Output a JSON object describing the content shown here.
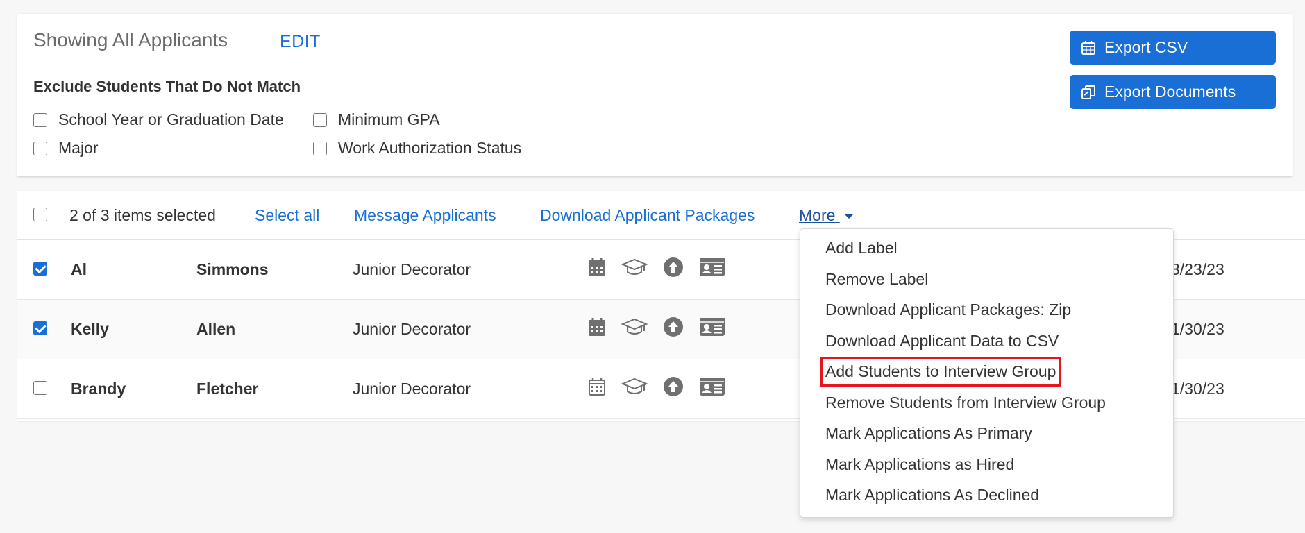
{
  "filters": {
    "title": "Showing All Applicants",
    "edit_label": "EDIT",
    "exclude_heading": "Exclude Students That Do Not Match",
    "options": [
      {
        "label": "School Year or Graduation Date",
        "checked": false
      },
      {
        "label": "Minimum GPA",
        "checked": false
      },
      {
        "label": "Major",
        "checked": false
      },
      {
        "label": "Work Authorization Status",
        "checked": false
      }
    ]
  },
  "actions": {
    "export_csv": "Export CSV",
    "export_documents": "Export Documents"
  },
  "toolbar": {
    "selected_text": "2 of 3 items selected",
    "select_all": "Select all",
    "message": "Message Applicants",
    "download": "Download Applicant Packages",
    "more": "More"
  },
  "rows": [
    {
      "first": "Al",
      "last": "Simmons",
      "title": "Junior Decorator",
      "date": "3/23/23",
      "checked": true
    },
    {
      "first": "Kelly",
      "last": "Allen",
      "title": "Junior Decorator",
      "date": "1/30/23",
      "checked": true
    },
    {
      "first": "Brandy",
      "last": "Fletcher",
      "title": "Junior Decorator",
      "date": "1/30/23",
      "checked": false
    }
  ],
  "more_menu": {
    "items": [
      "Add Label",
      "Remove Label",
      "Download Applicant Packages: Zip",
      "Download Applicant Data to CSV",
      "Add Students to Interview Group",
      "Remove Students from Interview Group",
      "Mark Applications As Primary",
      "Mark Applications as Hired",
      "Mark Applications As Declined"
    ],
    "highlighted_index": 4
  },
  "icons": [
    "calendar-icon",
    "graduation-cap-icon",
    "upload-circle-icon",
    "id-card-icon"
  ],
  "colors": {
    "accent": "#1a6fd6",
    "highlight": "#e8141c",
    "icon": "#707070"
  }
}
